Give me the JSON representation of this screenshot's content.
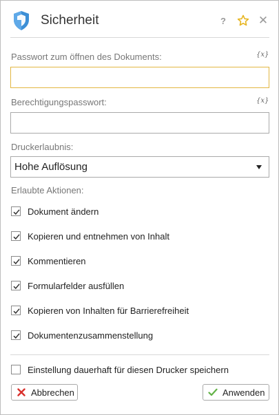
{
  "header": {
    "title": "Sicherheit",
    "help_label": "?",
    "close_label": "✕"
  },
  "fields": {
    "open_password": {
      "label": "Passwort zum öffnen des Dokuments:",
      "value": "",
      "var_label": "{x}"
    },
    "permission_password": {
      "label": "Berechtigungspasswort:",
      "value": "",
      "var_label": "{x}"
    }
  },
  "printing": {
    "label": "Druckerlaubnis:",
    "selected": "Hohe Auflösung"
  },
  "actions": {
    "label": "Erlaubte Aktionen:",
    "items": [
      {
        "label": "Dokument ändern",
        "checked": true
      },
      {
        "label": "Kopieren und entnehmen von Inhalt",
        "checked": true
      },
      {
        "label": "Kommentieren",
        "checked": true
      },
      {
        "label": "Formularfelder ausfüllen",
        "checked": true
      },
      {
        "label": "Kopieren von Inhalten für Barrierefreiheit",
        "checked": true
      },
      {
        "label": "Dokumentenzusammenstellung",
        "checked": true
      }
    ]
  },
  "save_setting": {
    "label": "Einstellung dauerhaft für diesen Drucker speichern",
    "checked": false
  },
  "buttons": {
    "cancel_label": "Abbrechen",
    "apply_label": "Anwenden"
  },
  "colors": {
    "focus_border": "#e2b640",
    "shield_blue": "#3d8fd6",
    "star_gold": "#e7b520",
    "cancel_red": "#d9302c",
    "apply_green": "#62b246"
  }
}
